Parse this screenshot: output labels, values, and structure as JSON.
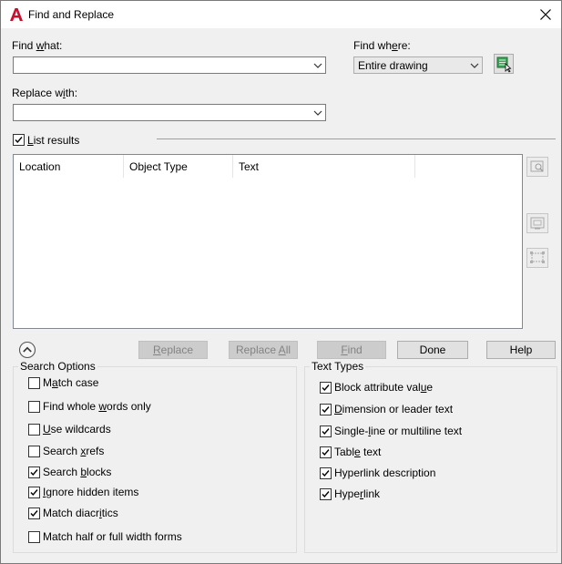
{
  "window": {
    "title": "Find and Replace",
    "close_icon": "close-icon",
    "app_icon": "autocad-a-icon"
  },
  "find_what": {
    "label": "Find what:",
    "value": ""
  },
  "replace_with": {
    "label": "Replace with:",
    "value": ""
  },
  "find_where": {
    "label": "Find where:",
    "selected": "Entire drawing"
  },
  "list_results": {
    "label": "List results",
    "checked": true
  },
  "results_table": {
    "columns": [
      "Location",
      "Object Type",
      "Text"
    ],
    "rows": []
  },
  "buttons": {
    "replace": "Replace",
    "replace_all": "Replace All",
    "find": "Find",
    "done": "Done",
    "help": "Help"
  },
  "search_options": {
    "title": "Search Options",
    "items": [
      {
        "label": "Match case",
        "checked": false
      },
      {
        "label": "Find whole words only",
        "checked": false
      },
      {
        "label": "Use wildcards",
        "checked": false
      },
      {
        "label": "Search xrefs",
        "checked": false
      },
      {
        "label": "Search blocks",
        "checked": true
      },
      {
        "label": "Ignore hidden items",
        "checked": true
      },
      {
        "label": "Match diacritics",
        "checked": true
      },
      {
        "label": "Match half or full width forms",
        "checked": false
      }
    ]
  },
  "text_types": {
    "title": "Text Types",
    "items": [
      {
        "label": "Block attribute value",
        "checked": true
      },
      {
        "label": "Dimension or leader text",
        "checked": true
      },
      {
        "label": "Single-line or multiline text",
        "checked": true
      },
      {
        "label": "Table text",
        "checked": true
      },
      {
        "label": "Hyperlink description",
        "checked": true
      },
      {
        "label": "Hyperlink",
        "checked": true
      }
    ]
  }
}
